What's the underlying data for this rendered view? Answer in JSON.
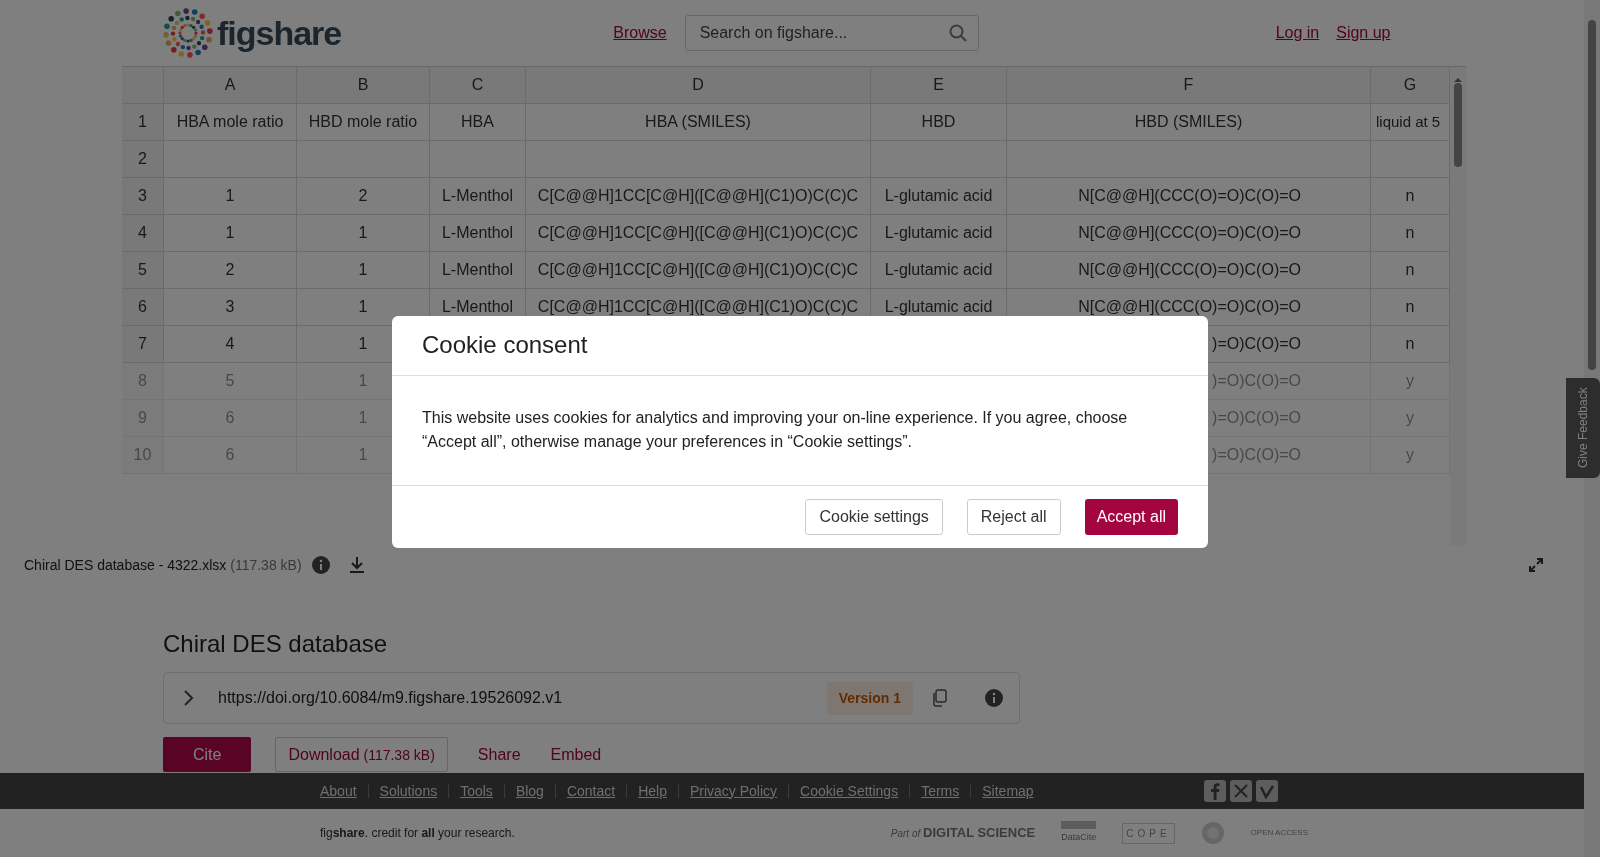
{
  "header": {
    "logo_text": "figshare",
    "nav_link": "Browse",
    "search": {
      "placeholder": "Search on figshare..."
    },
    "auth_links": [
      "Log in",
      "Sign up"
    ]
  },
  "spreadsheet": {
    "columns": [
      "A",
      "B",
      "C",
      "D",
      "E",
      "F",
      "G"
    ],
    "rows": [
      {
        "number": "1",
        "dimmed": false,
        "cells": [
          "HBA mole ratio",
          "HBD mole ratio",
          "HBA",
          "HBA (SMILES)",
          "HBD",
          "HBD (SMILES)",
          "liquid at 5"
        ]
      },
      {
        "number": "2",
        "dimmed": false,
        "cells": [
          null,
          null,
          null,
          null,
          null,
          null,
          null
        ]
      },
      {
        "number": "3",
        "dimmed": false,
        "cells": [
          "1",
          "2",
          "L-Menthol",
          "C[C@@H]1CC[C@H]([C@@H](C1)O)C(C)C",
          "L-glutamic acid",
          "N[C@@H](CCC(O)=O)C(O)=O",
          "n"
        ]
      },
      {
        "number": "4",
        "dimmed": false,
        "cells": [
          "1",
          "1",
          "L-Menthol",
          "C[C@@H]1CC[C@H]([C@@H](C1)O)C(C)C",
          "L-glutamic acid",
          "N[C@@H](CCC(O)=O)C(O)=O",
          "n"
        ]
      },
      {
        "number": "5",
        "dimmed": false,
        "cells": [
          "2",
          "1",
          "L-Menthol",
          "C[C@@H]1CC[C@H]([C@@H](C1)O)C(C)C",
          "L-glutamic acid",
          "N[C@@H](CCC(O)=O)C(O)=O",
          "n"
        ]
      },
      {
        "number": "6",
        "dimmed": false,
        "cells": [
          "3",
          "1",
          "L-Menthol",
          "C[C@@H]1CC[C@H]([C@@H](C1)O)C(C)C",
          "L-glutamic acid",
          "N[C@@H](CCC(O)=O)C(O)=O",
          "n"
        ]
      },
      {
        "number": "7",
        "dimmed": false,
        "cells": [
          "4",
          "1",
          null,
          null,
          null,
          ")=O)C(O)=O",
          "n"
        ]
      },
      {
        "number": "8",
        "dimmed": true,
        "cells": [
          "5",
          "1",
          null,
          null,
          null,
          ")=O)C(O)=O",
          "y"
        ]
      },
      {
        "number": "9",
        "dimmed": true,
        "cells": [
          "6",
          "1",
          null,
          null,
          null,
          ")=O)C(O)=O",
          "y"
        ]
      },
      {
        "number": "10",
        "dimmed": true,
        "cells": [
          "6",
          "1",
          null,
          null,
          null,
          ")=O)C(O)=O",
          "y"
        ]
      }
    ]
  },
  "file_bar": {
    "file_name": "Chiral DES database - 4322.xlsx",
    "size": "(117.38 kB)"
  },
  "article": {
    "title": "Chiral DES database",
    "doi": "https://doi.org/10.6084/m9.figshare.19526092.v1",
    "version": "Version 1",
    "actions": [
      {
        "label": "Cite",
        "kind": "primary"
      },
      {
        "label": "Download",
        "size": "(117.38 kB)",
        "kind": "outline"
      },
      {
        "label": "Share",
        "kind": "link"
      },
      {
        "label": "Embed",
        "kind": "link"
      }
    ]
  },
  "footer": {
    "links": [
      "About",
      "Solutions",
      "Tools",
      "Blog",
      "Contact",
      "Help",
      "Privacy Policy",
      "Cookie Settings",
      "Terms",
      "Sitemap"
    ],
    "tagline": "fig**share**. credit for **all** your research.",
    "partners": [
      {
        "kind": "digital-science",
        "prefix": "Part of",
        "text": "DIGITAL SCIENCE"
      },
      {
        "kind": "datacite",
        "text": "DataCite"
      },
      {
        "kind": "cope",
        "text": "COPE"
      },
      {
        "kind": "emblem"
      },
      {
        "kind": "open-access",
        "text": "OPEN ACCESS"
      }
    ]
  },
  "feedback_tab": "Give Feedback",
  "cookie_dialog": {
    "title": "Cookie consent",
    "text": "This website uses cookies for analytics and improving your on-line experience. If you agree, choose “Accept all”, otherwise manage your preferences in “Cookie settings”.",
    "buttons": [
      {
        "label": "Cookie settings",
        "kind": "outline"
      },
      {
        "label": "Reject all",
        "kind": "outline"
      },
      {
        "label": "Accept all",
        "kind": "primary"
      }
    ]
  }
}
